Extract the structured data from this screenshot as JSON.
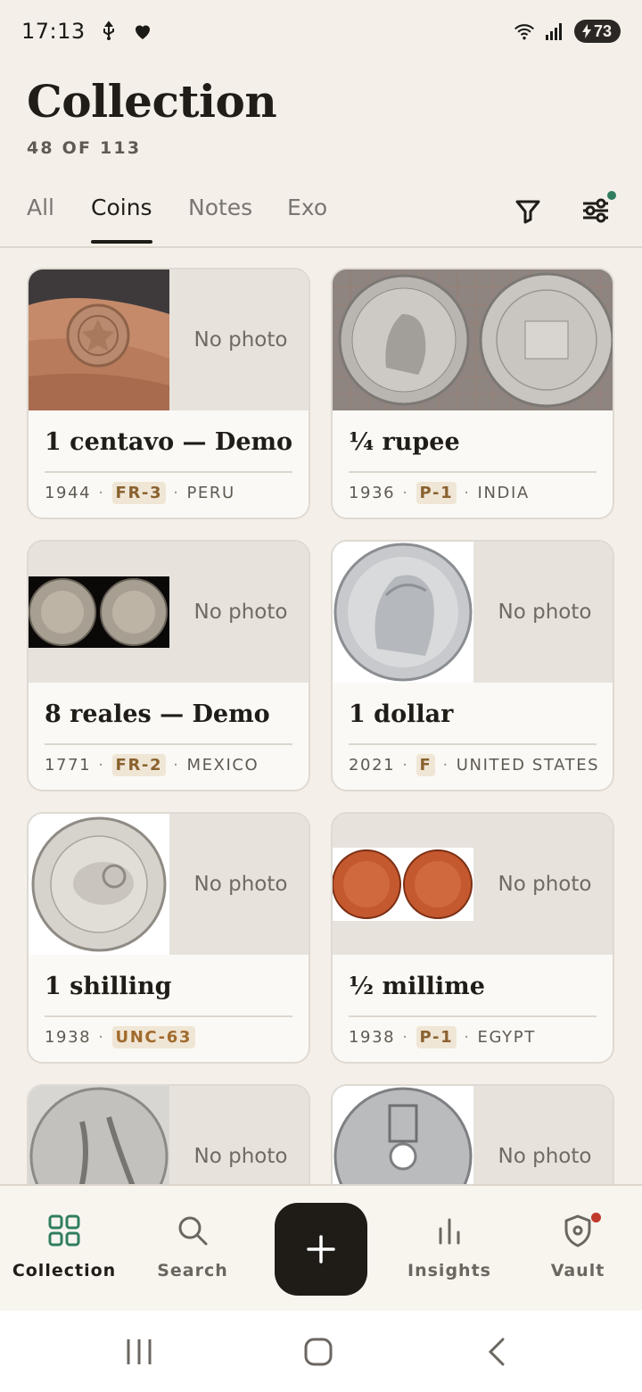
{
  "status_bar": {
    "time": "17:13",
    "battery": "73",
    "icons": [
      "usb-icon",
      "heart-icon",
      "wifi-icon",
      "signal-icon",
      "battery-icon"
    ]
  },
  "header": {
    "title": "Collection",
    "count": "48 OF 113"
  },
  "tabs": [
    {
      "label": "All"
    },
    {
      "label": "Coins"
    },
    {
      "label": "Notes"
    },
    {
      "label": "Exo"
    }
  ],
  "active_tab": "Coins",
  "no_photo_label": "No photo",
  "cards": [
    {
      "name": "1 centavo — Demo",
      "year": "1944",
      "grade": "FR-3",
      "country": "PERU",
      "photo": "coin-in-hand"
    },
    {
      "name": "¼ rupee",
      "year": "1936",
      "grade": "P-1",
      "country": "INDIA",
      "photo": "rupee-both-sides"
    },
    {
      "name": "8 reales — Demo",
      "year": "1771",
      "grade": "FR-2",
      "country": "MEXICO",
      "photo": "reales-both-sides"
    },
    {
      "name": "1 dollar",
      "year": "2021",
      "grade": "F",
      "country": "UNITED STATES",
      "photo": "morgan-dollar"
    },
    {
      "name": "1 shilling",
      "year": "1938",
      "grade": "UNC-63",
      "country": "",
      "photo": "australia-shilling"
    },
    {
      "name": "½ millime",
      "year": "1938",
      "grade": "P-1",
      "country": "EGYPT",
      "photo": "millime-both-sides"
    },
    {
      "name": "",
      "year": "",
      "grade": "",
      "country": "",
      "photo": "italy-coin"
    },
    {
      "name": "",
      "year": "",
      "grade": "",
      "country": "",
      "photo": "norway-holed-coin"
    }
  ],
  "bottom_nav": [
    {
      "label": "Collection",
      "icon": "grid-icon"
    },
    {
      "label": "Search",
      "icon": "search-icon"
    },
    {
      "label": "",
      "icon": "plus-icon"
    },
    {
      "label": "Insights",
      "icon": "bar-chart-icon"
    },
    {
      "label": "Vault",
      "icon": "shield-icon"
    }
  ],
  "colors": {
    "background": "#f4f0e9",
    "accent_dark": "#1f1c18",
    "notification_green": "#2f7d5f",
    "notification_red": "#c0392b",
    "grade_bg": "#f0e6d6"
  }
}
